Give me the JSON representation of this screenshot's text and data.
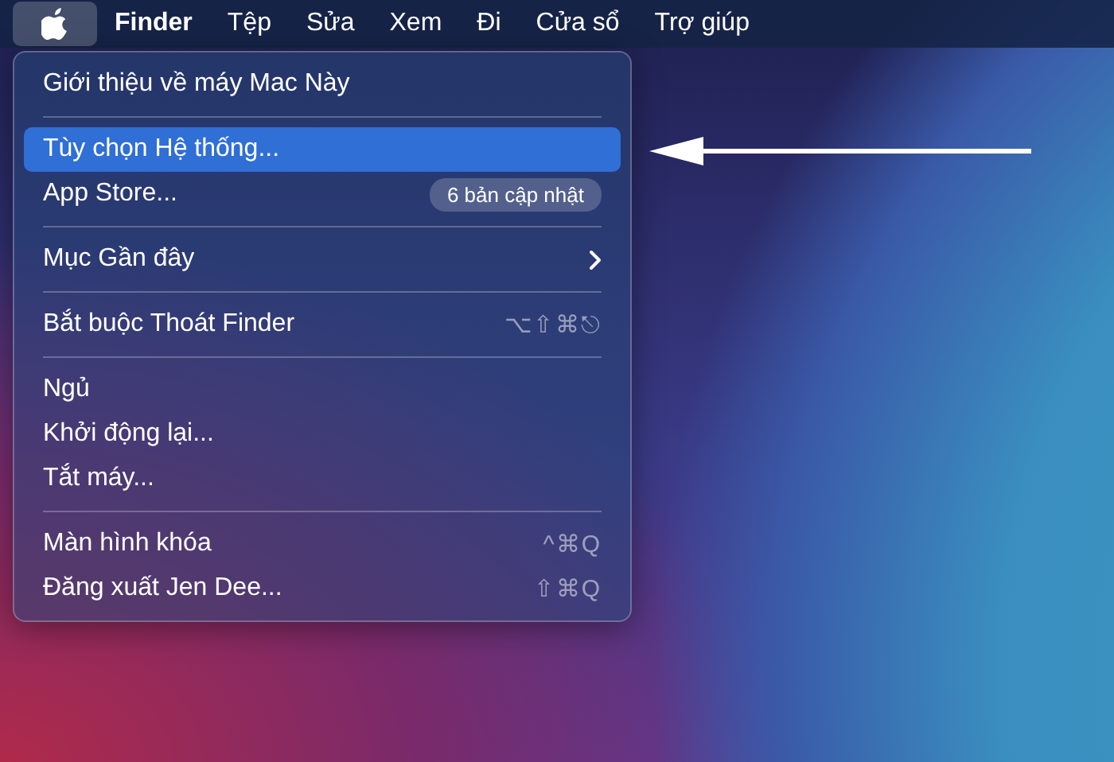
{
  "menu_bar": {
    "items": [
      {
        "kind": "apple",
        "selected": true
      },
      {
        "kind": "app",
        "label": "Finder",
        "selected": false
      },
      {
        "kind": "menu",
        "label": "Tệp",
        "selected": false
      },
      {
        "kind": "menu",
        "label": "Sửa",
        "selected": false
      },
      {
        "kind": "menu",
        "label": "Xem",
        "selected": false
      },
      {
        "kind": "menu",
        "label": "Đi",
        "selected": false
      },
      {
        "kind": "menu",
        "label": "Cửa sổ",
        "selected": false
      },
      {
        "kind": "menu",
        "label": "Trợ giúp",
        "selected": false
      }
    ]
  },
  "apple_menu": {
    "sections": [
      [
        {
          "label": "Giới thiệu về máy Mac Này",
          "selected": false
        }
      ],
      [
        {
          "label": "Tùy chọn Hệ thống...",
          "selected": true
        },
        {
          "label": "App Store...",
          "selected": false,
          "badge": "6 bản cập nhật"
        }
      ],
      [
        {
          "label": "Mục Gần đây",
          "selected": false,
          "submenu": true
        }
      ],
      [
        {
          "label": "Bắt buộc Thoát Finder",
          "selected": false,
          "shortcut": "⌥⇧⌘⎋"
        }
      ],
      [
        {
          "label": "Ngủ",
          "selected": false
        },
        {
          "label": "Khởi động lại...",
          "selected": false
        },
        {
          "label": "Tắt máy...",
          "selected": false
        }
      ],
      [
        {
          "label": "Màn hình khóa",
          "selected": false,
          "shortcut": "^⌘Q"
        },
        {
          "label": "Đăng xuất Jen Dee...",
          "selected": false,
          "shortcut": "⇧⌘Q"
        }
      ]
    ]
  }
}
